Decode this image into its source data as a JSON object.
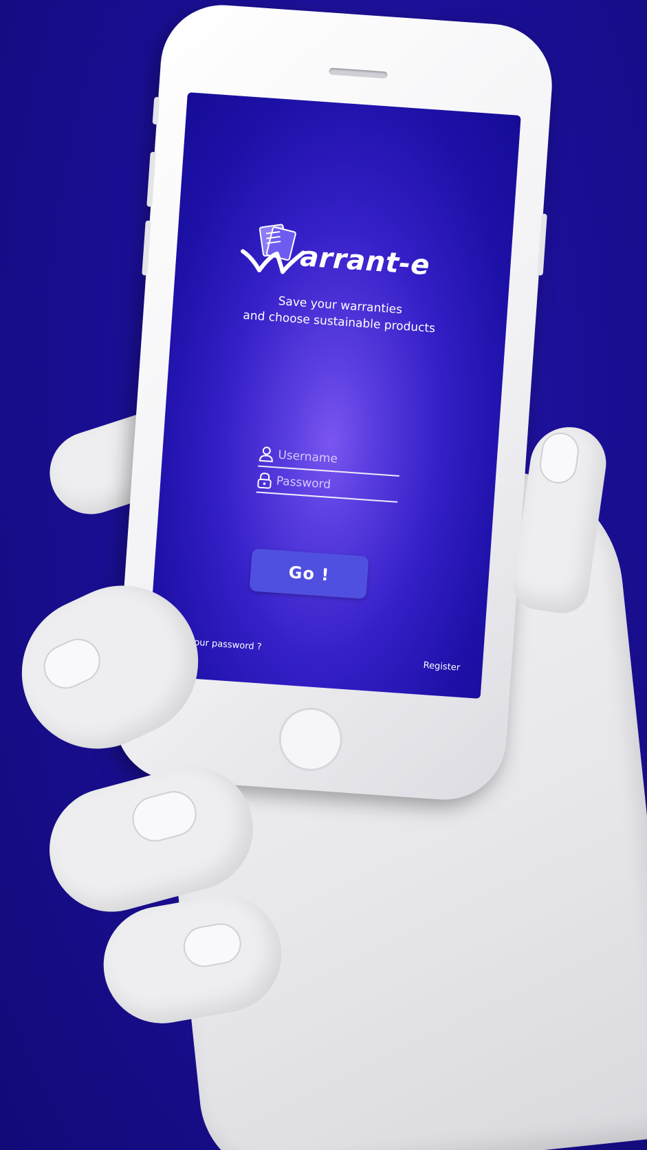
{
  "app": {
    "name": "arrant-e",
    "tagline_line1": "Save your warranties",
    "tagline_line2": "and choose sustainable products"
  },
  "login_form": {
    "username_placeholder": "Username",
    "password_placeholder": "Password",
    "submit_label": "Go !"
  },
  "links": {
    "forgot_password": "Forgot your password ?",
    "register": "Register"
  },
  "icons": {
    "logo": "warranty-documents-icon",
    "username": "user-icon",
    "password": "lock-icon"
  },
  "colors": {
    "background": "#1a0f95",
    "screen_glow": "#7a56ef",
    "button": "#5050e0",
    "text": "#ffffff"
  }
}
